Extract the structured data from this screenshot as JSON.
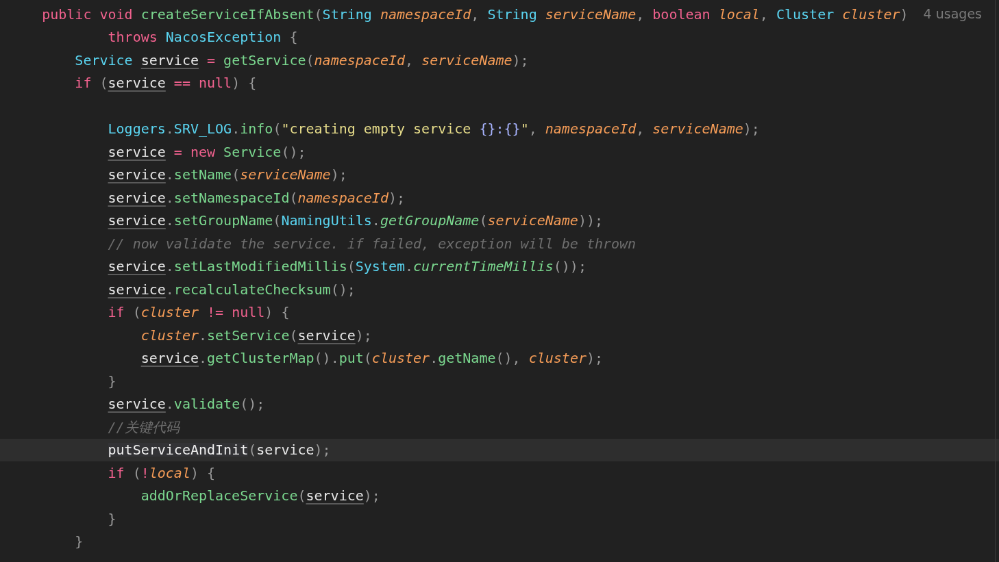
{
  "editor": {
    "lines": [
      {
        "current": false,
        "tokens": [
          {
            "text": "public void ",
            "kind": "keyword"
          },
          {
            "text": "createServiceIfAbsent",
            "kind": "method"
          },
          {
            "text": "(",
            "kind": "punctuation"
          },
          {
            "text": "String ",
            "kind": "type"
          },
          {
            "text": "namespaceId",
            "kind": "parameter"
          },
          {
            "text": ", ",
            "kind": "punctuation"
          },
          {
            "text": "String ",
            "kind": "type"
          },
          {
            "text": "serviceName",
            "kind": "parameter"
          },
          {
            "text": ", ",
            "kind": "punctuation"
          },
          {
            "text": "boolean ",
            "kind": "keyword"
          },
          {
            "text": "local",
            "kind": "parameter"
          },
          {
            "text": ", ",
            "kind": "punctuation"
          },
          {
            "text": "Cluster ",
            "kind": "type"
          },
          {
            "text": "cluster",
            "kind": "parameter"
          },
          {
            "text": ")",
            "kind": "punctuation"
          }
        ],
        "hint": "4 usages",
        "continuation": {
          "current": false,
          "tokens": [
            {
              "text": "throws ",
              "kind": "keyword"
            },
            {
              "text": "NacosException ",
              "kind": "type"
            },
            {
              "text": "{",
              "kind": "punctuation"
            }
          ]
        },
        "children": [
          {
            "current": false,
            "tokens": [
              {
                "text": "Service ",
                "kind": "type"
              },
              {
                "text": "service",
                "kind": "variable"
              },
              {
                "text": " = ",
                "kind": "operator"
              },
              {
                "text": "getService",
                "kind": "method"
              },
              {
                "text": "(",
                "kind": "punctuation"
              },
              {
                "text": "namespaceId",
                "kind": "parameter"
              },
              {
                "text": ", ",
                "kind": "punctuation"
              },
              {
                "text": "serviceName",
                "kind": "parameter"
              },
              {
                "text": ");",
                "kind": "punctuation"
              }
            ]
          },
          {
            "current": false,
            "tokens": [
              {
                "text": "if ",
                "kind": "keyword"
              },
              {
                "text": "(",
                "kind": "punctuation"
              },
              {
                "text": "service",
                "kind": "variable"
              },
              {
                "text": " == ",
                "kind": "operator"
              },
              {
                "text": "null",
                "kind": "keyword"
              },
              {
                "text": ") {",
                "kind": "punctuation"
              }
            ],
            "children": [
              {
                "current": false
              },
              {
                "current": false,
                "tokens": [
                  {
                    "text": "Loggers",
                    "kind": "type"
                  },
                  {
                    "text": ".",
                    "kind": "punctuation"
                  },
                  {
                    "text": "SRV_LOG",
                    "kind": "type"
                  },
                  {
                    "text": ".",
                    "kind": "punctuation"
                  },
                  {
                    "text": "info",
                    "kind": "method"
                  },
                  {
                    "text": "(",
                    "kind": "punctuation"
                  },
                  {
                    "text": "\"creating empty service ",
                    "kind": "string"
                  },
                  {
                    "text": "{}:{}",
                    "kind": "format"
                  },
                  {
                    "text": "\"",
                    "kind": "string"
                  },
                  {
                    "text": ", ",
                    "kind": "punctuation"
                  },
                  {
                    "text": "namespaceId",
                    "kind": "parameter"
                  },
                  {
                    "text": ", ",
                    "kind": "punctuation"
                  },
                  {
                    "text": "serviceName",
                    "kind": "parameter"
                  },
                  {
                    "text": ");",
                    "kind": "punctuation"
                  }
                ]
              },
              {
                "current": false,
                "tokens": [
                  {
                    "text": "service",
                    "kind": "variable"
                  },
                  {
                    "text": " = ",
                    "kind": "operator"
                  },
                  {
                    "text": "new ",
                    "kind": "keyword"
                  },
                  {
                    "text": "Service",
                    "kind": "method"
                  },
                  {
                    "text": "();",
                    "kind": "punctuation"
                  }
                ]
              },
              {
                "current": false,
                "tokens": [
                  {
                    "text": "service",
                    "kind": "variable"
                  },
                  {
                    "text": ".",
                    "kind": "punctuation"
                  },
                  {
                    "text": "setName",
                    "kind": "method"
                  },
                  {
                    "text": "(",
                    "kind": "punctuation"
                  },
                  {
                    "text": "serviceName",
                    "kind": "parameter"
                  },
                  {
                    "text": ");",
                    "kind": "punctuation"
                  }
                ]
              },
              {
                "current": false,
                "tokens": [
                  {
                    "text": "service",
                    "kind": "variable"
                  },
                  {
                    "text": ".",
                    "kind": "punctuation"
                  },
                  {
                    "text": "setNamespaceId",
                    "kind": "method"
                  },
                  {
                    "text": "(",
                    "kind": "punctuation"
                  },
                  {
                    "text": "namespaceId",
                    "kind": "parameter"
                  },
                  {
                    "text": ");",
                    "kind": "punctuation"
                  }
                ]
              },
              {
                "current": false,
                "tokens": [
                  {
                    "text": "service",
                    "kind": "variable"
                  },
                  {
                    "text": ".",
                    "kind": "punctuation"
                  },
                  {
                    "text": "setGroupName",
                    "kind": "method"
                  },
                  {
                    "text": "(",
                    "kind": "punctuation"
                  },
                  {
                    "text": "NamingUtils",
                    "kind": "type"
                  },
                  {
                    "text": ".",
                    "kind": "punctuation"
                  },
                  {
                    "text": "getGroupName",
                    "kind": "static"
                  },
                  {
                    "text": "(",
                    "kind": "punctuation"
                  },
                  {
                    "text": "serviceName",
                    "kind": "parameter"
                  },
                  {
                    "text": "));",
                    "kind": "punctuation"
                  }
                ]
              },
              {
                "current": false,
                "tokens": [
                  {
                    "text": "// now validate the service. if failed, exception will be thrown",
                    "kind": "comment"
                  }
                ]
              },
              {
                "current": false,
                "tokens": [
                  {
                    "text": "service",
                    "kind": "variable"
                  },
                  {
                    "text": ".",
                    "kind": "punctuation"
                  },
                  {
                    "text": "setLastModifiedMillis",
                    "kind": "method"
                  },
                  {
                    "text": "(",
                    "kind": "punctuation"
                  },
                  {
                    "text": "System",
                    "kind": "type"
                  },
                  {
                    "text": ".",
                    "kind": "punctuation"
                  },
                  {
                    "text": "currentTimeMillis",
                    "kind": "static"
                  },
                  {
                    "text": "());",
                    "kind": "punctuation"
                  }
                ]
              },
              {
                "current": false,
                "tokens": [
                  {
                    "text": "service",
                    "kind": "variable"
                  },
                  {
                    "text": ".",
                    "kind": "punctuation"
                  },
                  {
                    "text": "recalculateChecksum",
                    "kind": "method"
                  },
                  {
                    "text": "();",
                    "kind": "punctuation"
                  }
                ]
              },
              {
                "current": false,
                "tokens": [
                  {
                    "text": "if ",
                    "kind": "keyword"
                  },
                  {
                    "text": "(",
                    "kind": "punctuation"
                  },
                  {
                    "text": "cluster",
                    "kind": "parameter"
                  },
                  {
                    "text": " != ",
                    "kind": "operator"
                  },
                  {
                    "text": "null",
                    "kind": "keyword"
                  },
                  {
                    "text": ") {",
                    "kind": "punctuation"
                  }
                ],
                "children": [
                  {
                    "current": false,
                    "tokens": [
                      {
                        "text": "cluster",
                        "kind": "parameter"
                      },
                      {
                        "text": ".",
                        "kind": "punctuation"
                      },
                      {
                        "text": "setService",
                        "kind": "method"
                      },
                      {
                        "text": "(",
                        "kind": "punctuation"
                      },
                      {
                        "text": "service",
                        "kind": "variable"
                      },
                      {
                        "text": ");",
                        "kind": "punctuation"
                      }
                    ]
                  },
                  {
                    "current": false,
                    "tokens": [
                      {
                        "text": "service",
                        "kind": "variable"
                      },
                      {
                        "text": ".",
                        "kind": "punctuation"
                      },
                      {
                        "text": "getClusterMap",
                        "kind": "method"
                      },
                      {
                        "text": "().",
                        "kind": "punctuation"
                      },
                      {
                        "text": "put",
                        "kind": "method"
                      },
                      {
                        "text": "(",
                        "kind": "punctuation"
                      },
                      {
                        "text": "cluster",
                        "kind": "parameter"
                      },
                      {
                        "text": ".",
                        "kind": "punctuation"
                      },
                      {
                        "text": "getName",
                        "kind": "method"
                      },
                      {
                        "text": "(), ",
                        "kind": "punctuation"
                      },
                      {
                        "text": "cluster",
                        "kind": "parameter"
                      },
                      {
                        "text": ");",
                        "kind": "punctuation"
                      }
                    ]
                  }
                ]
              },
              {
                "current": false,
                "tokens": [
                  {
                    "text": "}",
                    "kind": "punctuation"
                  }
                ]
              },
              {
                "current": false,
                "tokens": [
                  {
                    "text": "service",
                    "kind": "variable"
                  },
                  {
                    "text": ".",
                    "kind": "punctuation"
                  },
                  {
                    "text": "validate",
                    "kind": "method"
                  },
                  {
                    "text": "();",
                    "kind": "punctuation"
                  }
                ]
              },
              {
                "current": false,
                "tokens": [
                  {
                    "text": "//关键代码",
                    "kind": "comment"
                  }
                ]
              },
              {
                "current": true,
                "tokens": [
                  {
                    "text": "putServiceAndInit",
                    "kind": "call"
                  },
                  {
                    "text": "(",
                    "kind": "punctuation"
                  },
                  {
                    "text": "service",
                    "kind": "plain"
                  },
                  {
                    "text": ");",
                    "kind": "punctuation"
                  }
                ]
              },
              {
                "current": false,
                "tokens": [
                  {
                    "text": "if ",
                    "kind": "keyword"
                  },
                  {
                    "text": "(",
                    "kind": "punctuation"
                  },
                  {
                    "text": "!",
                    "kind": "operator"
                  },
                  {
                    "text": "local",
                    "kind": "parameter"
                  },
                  {
                    "text": ") {",
                    "kind": "punctuation"
                  }
                ],
                "children": [
                  {
                    "current": false,
                    "tokens": [
                      {
                        "text": "addOrReplaceService",
                        "kind": "method"
                      },
                      {
                        "text": "(",
                        "kind": "punctuation"
                      },
                      {
                        "text": "service",
                        "kind": "variable"
                      },
                      {
                        "text": ");",
                        "kind": "punctuation"
                      }
                    ]
                  }
                ]
              },
              {
                "current": false,
                "tokens": [
                  {
                    "text": "}",
                    "kind": "punctuation"
                  }
                ]
              }
            ]
          },
          {
            "current": false,
            "tokens": [
              {
                "text": "}",
                "kind": "punctuation"
              }
            ]
          }
        ]
      }
    ]
  }
}
